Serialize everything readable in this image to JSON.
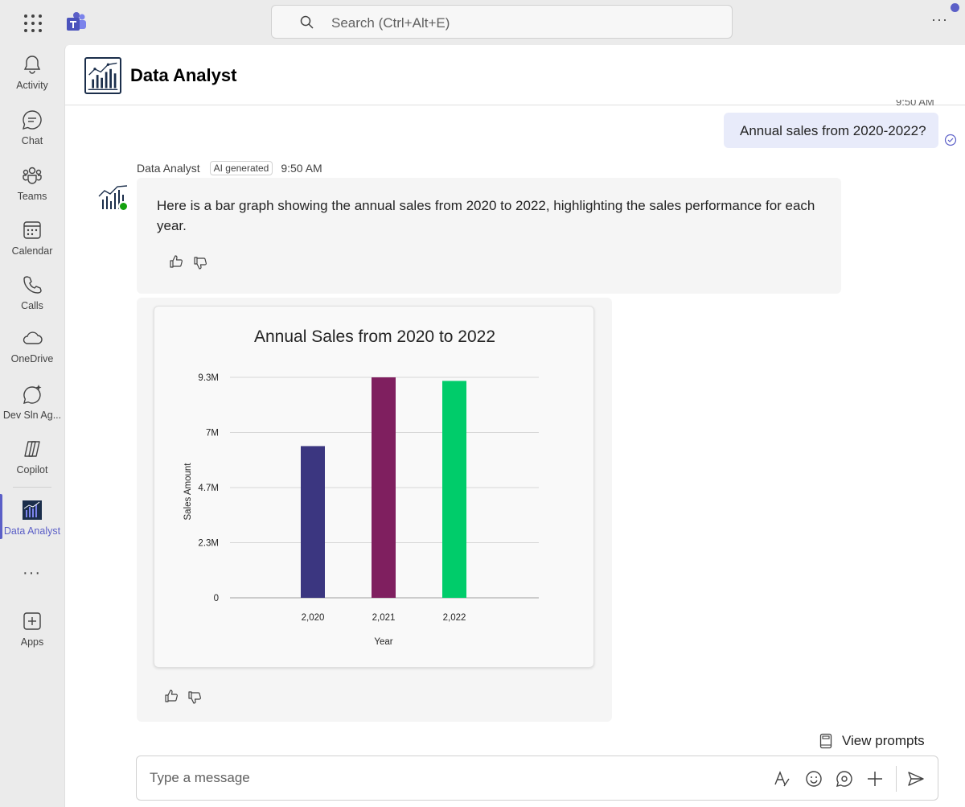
{
  "search": {
    "placeholder": "Search (Ctrl+Alt+E)"
  },
  "rail": {
    "items": [
      {
        "label": "Activity",
        "icon": "bell-icon"
      },
      {
        "label": "Chat",
        "icon": "chat-icon"
      },
      {
        "label": "Teams",
        "icon": "teams-icon"
      },
      {
        "label": "Calendar",
        "icon": "calendar-icon"
      },
      {
        "label": "Calls",
        "icon": "phone-icon"
      },
      {
        "label": "OneDrive",
        "icon": "cloud-icon"
      },
      {
        "label": "Dev Sln Ag...",
        "icon": "sparkle-chat-icon"
      },
      {
        "label": "Copilot",
        "icon": "copilot-icon"
      },
      {
        "label": "Data Analyst",
        "icon": "data-analyst-app-icon",
        "active": true
      },
      {
        "label": "Apps",
        "icon": "add-apps-icon"
      }
    ]
  },
  "header": {
    "title": "Data Analyst"
  },
  "conversation": {
    "cut_time": "9:50 AM",
    "user_message": "Annual sales from 2020-2022?",
    "bot_name": "Data Analyst",
    "ai_tag": "AI generated",
    "bot_time": "9:50 AM",
    "bot_message": "Here is a bar graph showing the annual sales from 2020 to 2022, highlighting the sales performance for each year."
  },
  "chart_data": {
    "type": "bar",
    "title": "Annual Sales from 2020 to 2022",
    "xlabel": "Year",
    "ylabel": "Sales Amount",
    "categories": [
      "2,020",
      "2,021",
      "2,022"
    ],
    "values": [
      6400000,
      9300000,
      9150000
    ],
    "colors": [
      "#3b3680",
      "#7f1f5f",
      "#00cc6a"
    ],
    "ylim": [
      0,
      9300000
    ],
    "yticks": [
      {
        "value": 0,
        "label": "0"
      },
      {
        "value": 2325000,
        "label": "2.3M"
      },
      {
        "value": 4650000,
        "label": "4.7M"
      },
      {
        "value": 6975000,
        "label": "7M"
      },
      {
        "value": 9300000,
        "label": "9.3M"
      }
    ],
    "grid": true
  },
  "footer": {
    "view_prompts": "View prompts",
    "composer_placeholder": "Type a message"
  },
  "colors": {
    "brand": "#5b5fc7",
    "user_bubble": "#e8ebfa",
    "bot_bubble": "#f5f5f5"
  }
}
